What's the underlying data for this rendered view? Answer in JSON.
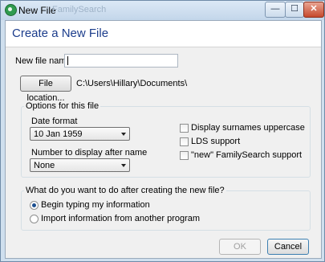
{
  "window": {
    "title": "New File",
    "title_ghost": "FamilySearch",
    "minimize_glyph": "—",
    "maximize_glyph": "☐",
    "close_glyph": "✕"
  },
  "header": {
    "title": "Create a New File"
  },
  "file": {
    "name_label": "New file name",
    "name_value": "",
    "location_button": "File location...",
    "location_path": "C:\\Users\\Hillary\\Documents\\"
  },
  "options": {
    "group_title": "Options for this file",
    "date_format_label": "Date format",
    "date_format_value": "10 Jan 1959",
    "number_label": "Number to display after name",
    "number_value": "None",
    "checkboxes": [
      {
        "label": "Display surnames uppercase",
        "checked": false
      },
      {
        "label": "LDS support",
        "checked": false
      },
      {
        "label": "\"new\" FamilySearch support",
        "checked": false
      }
    ]
  },
  "after": {
    "group_title": "What do you want to do after creating the new file?",
    "radios": [
      {
        "label": "Begin typing my information",
        "checked": true
      },
      {
        "label": "Import information from another program",
        "checked": false
      }
    ]
  },
  "footer": {
    "ok_label": "OK",
    "cancel_label": "Cancel"
  },
  "icons": {
    "app": "rootsmagic-app-icon",
    "dropdown": "chevron-down-icon"
  }
}
